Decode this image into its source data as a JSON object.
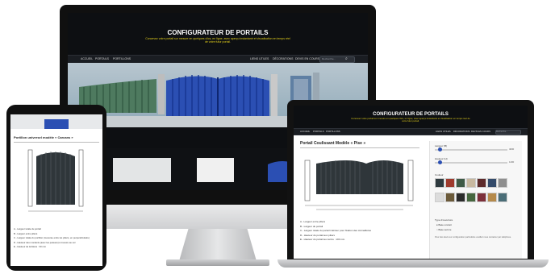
{
  "imac": {
    "title": "CONFIGURATEUR DE PORTAILS",
    "tagline": "Concevez votre portail sur mesure en quelques clics, en ligne, avec aperçu instantané et visualisation en temps réel de votre futur portail.",
    "nav": [
      "ACCUEIL",
      "PORTAILS",
      "PORTILLONS"
    ],
    "nav_right": [
      "LIENS UTILES",
      "DÉCORATIONS",
      "DEVIS EN COURS"
    ],
    "search_placeholder": "Recherche...",
    "colors": {
      "green_gate": "#4e7a5f",
      "blue_gate": "#2b4fb3",
      "sky": "#8fa9b8"
    }
  },
  "laptop": {
    "title": "CONFIGURATEUR DE PORTAILS",
    "tagline": "Concevez votre portail sur mesure en quelques clics, en ligne, avec aperçu instantané et visualisation en temps réel de votre futur portail.",
    "nav": [
      "ACCUEIL",
      "PORTAILS",
      "PORTILLONS"
    ],
    "nav_right": [
      "LIENS UTILES",
      "DÉCORATIONS",
      "DEVIS EN COURS"
    ],
    "search_placeholder": "Recherche...",
    "product_title": "Portail Coulissant Modèle « Pise »",
    "legend": [
      "A - Largeur entre piliers",
      "B - Largeur du portail",
      "C - Largeur totale du portail intérieur pour fixation des crémaillères",
      "D - Hauteur du portail aux piliers",
      "E - Hauteur du portail au centre : 100 mm"
    ],
    "width_label": "Largeur (B)",
    "width_value": "4000",
    "height_label": "Hauteur (H)",
    "height_value": "1400",
    "colors_label": "Couleur",
    "swatch_colors": [
      "#2e3a3f",
      "#9e3a2d",
      "#3e5a46",
      "#c8b9a0",
      "#5d2a2a",
      "#344b6a",
      "#8f8f8f",
      "#dcdcdc",
      "#6b5a3a",
      "#2b2b2b",
      "#46663f",
      "#7c2f3a",
      "#b58a4b",
      "#4a6d77"
    ],
    "option_title": "Type d'ouverture",
    "option_a": "Base ouvrant",
    "option_b": "Base serrure",
    "footer_note": "Pour des devis sur configuration particulière veuillez nous contacter par téléphone.",
    "gate_color": "#2f363a"
  },
  "tablet": {
    "product_title": "Portillon universel modèle « Carcans »",
    "legend": [
      "A - Largeur totale du portail",
      "B - Largeur entre piliers",
      "C - Largeur totale du portillon (mesurée entre les piliers, en perpendiculaire)",
      "D - Hauteur des montants (avec les poteaux) à mesure au sol",
      "E - Hauteur de la lisière : 30 mm"
    ],
    "gate_color": "#2f363a",
    "accent": "#2b4fb3"
  }
}
